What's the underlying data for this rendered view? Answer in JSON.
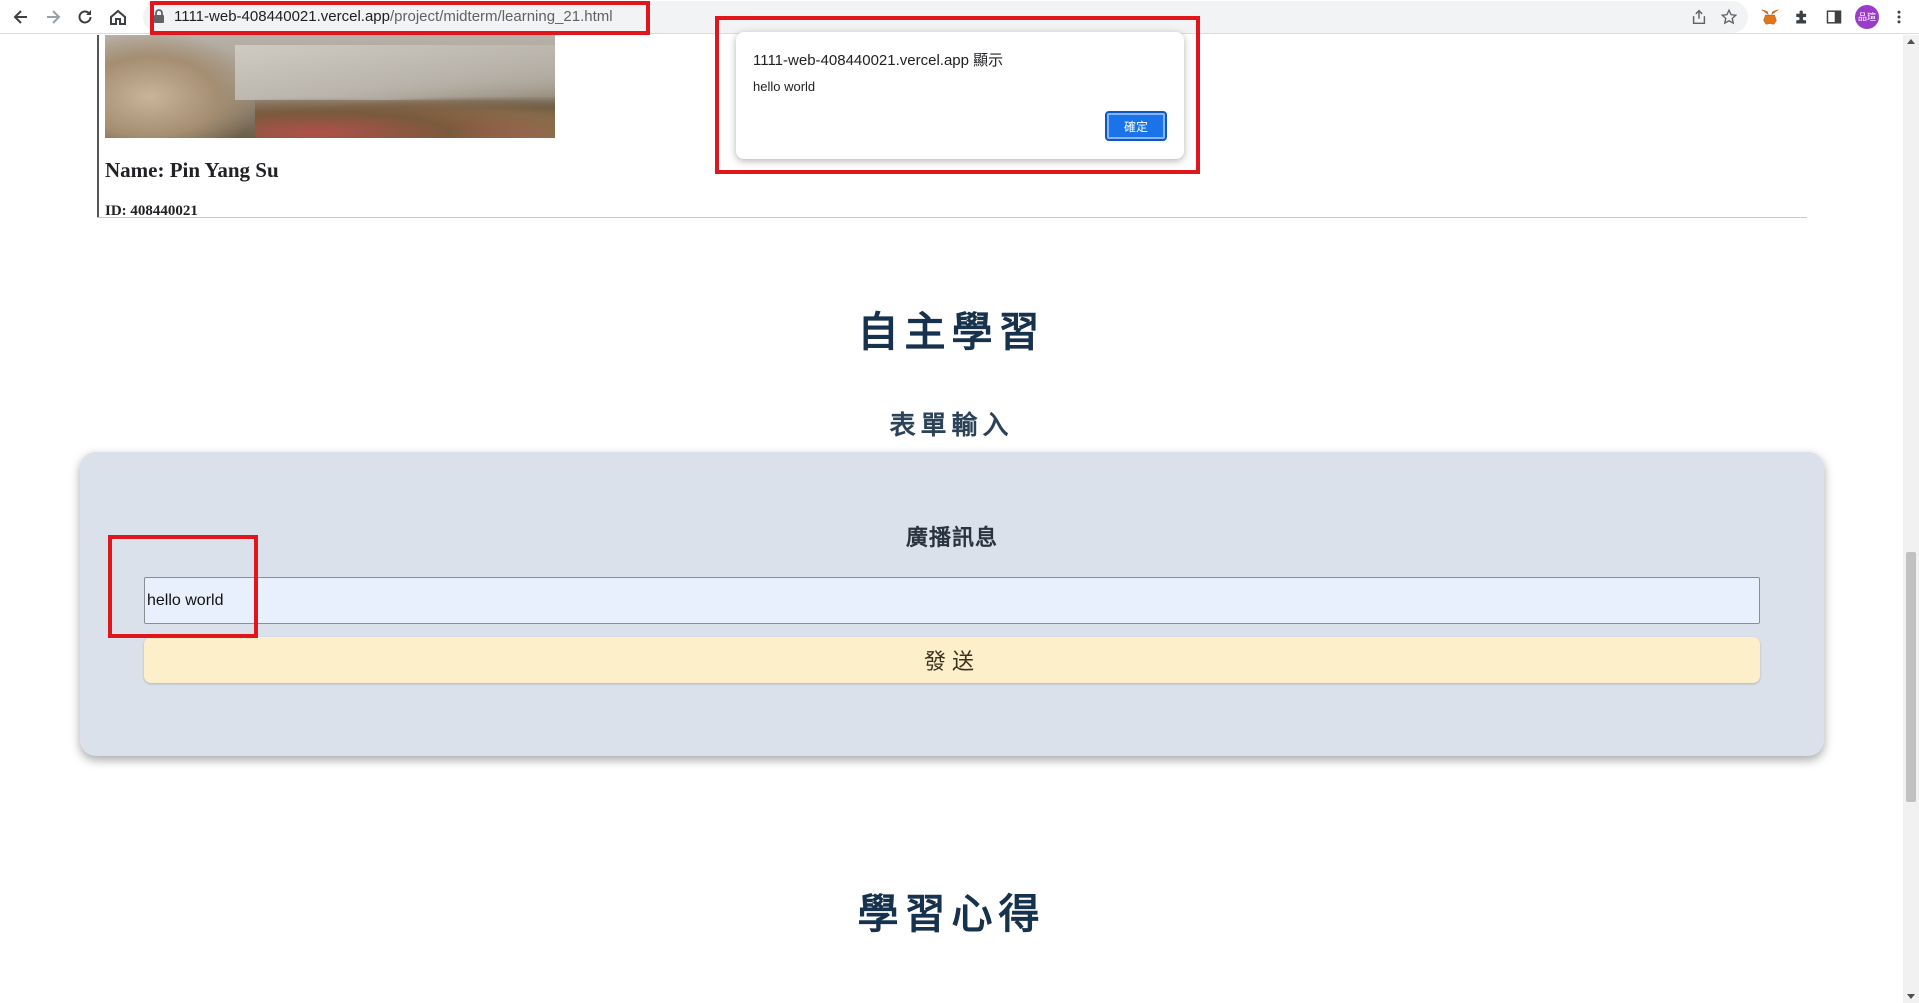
{
  "browser": {
    "url_host": "1111-web-408440021.vercel.app",
    "url_path": "/project/midterm/learning_21.html",
    "avatar_text": "品瑄",
    "icons": [
      "back-icon",
      "forward-icon",
      "reload-icon",
      "home-icon",
      "lock-icon",
      "share-icon",
      "star-icon",
      "metamask-icon",
      "extensions-icon",
      "sidepanel-icon",
      "avatar",
      "menu-icon"
    ]
  },
  "profile": {
    "name": "Name: Pin Yang Su",
    "id": "ID: 408440021"
  },
  "sections": {
    "learning_title": "自主學習",
    "form_title": "表單輸入",
    "reflection_title": "學習心得"
  },
  "form": {
    "label": "廣播訊息",
    "input_value": "hello world",
    "send_label": "發送",
    "colors": {
      "card_bg": "#dbe1ea",
      "button_bg": "#fcefca",
      "input_bg": "#e8f0fe"
    }
  },
  "alert": {
    "title": "1111-web-408440021.vercel.app 顯示",
    "message": "hello world",
    "ok_label": "確定"
  },
  "annotations": {
    "color": "#e0161c",
    "boxes": [
      "url-bar",
      "alert-dialog",
      "input-value"
    ]
  }
}
